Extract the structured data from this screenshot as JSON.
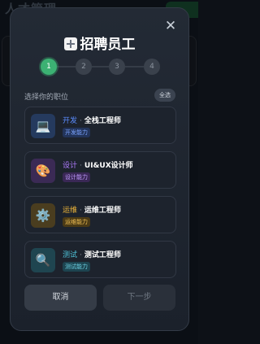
{
  "background": {
    "title": "人才管理"
  },
  "modal": {
    "title": "招聘员工",
    "close_symbol": "✕",
    "title_icon": "plus-icon",
    "steps": [
      "1",
      "2",
      "3",
      "4"
    ],
    "active_step": "1",
    "section_label": "选择你的职位",
    "select_all_label": "全选",
    "roles": [
      {
        "category": "开发",
        "job": "全栈工程师",
        "badge": "开发能力",
        "icon": "laptop-icon",
        "emoji": "💻",
        "accent": "#5b8cff",
        "icon_bg": "#253a5e"
      },
      {
        "category": "设计",
        "job": "UI&UX设计师",
        "badge": "设计能力",
        "icon": "palette-icon",
        "emoji": "🎨",
        "accent": "#b07cff",
        "icon_bg": "#3b2a55"
      },
      {
        "category": "运维",
        "job": "运维工程师",
        "badge": "运维能力",
        "icon": "gear-icon",
        "emoji": "⚙️",
        "accent": "#f2b83a",
        "icon_bg": "#4a3d1f"
      },
      {
        "category": "测试",
        "job": "测试工程师",
        "badge": "测试能力",
        "icon": "magnifier-icon",
        "emoji": "🔍",
        "accent": "#4fc3d9",
        "icon_bg": "#1f4550"
      }
    ],
    "cancel_label": "取消",
    "next_label": "下一步"
  },
  "colors": {
    "active_step": "#3cb173",
    "modal_bg": "#232a35"
  }
}
